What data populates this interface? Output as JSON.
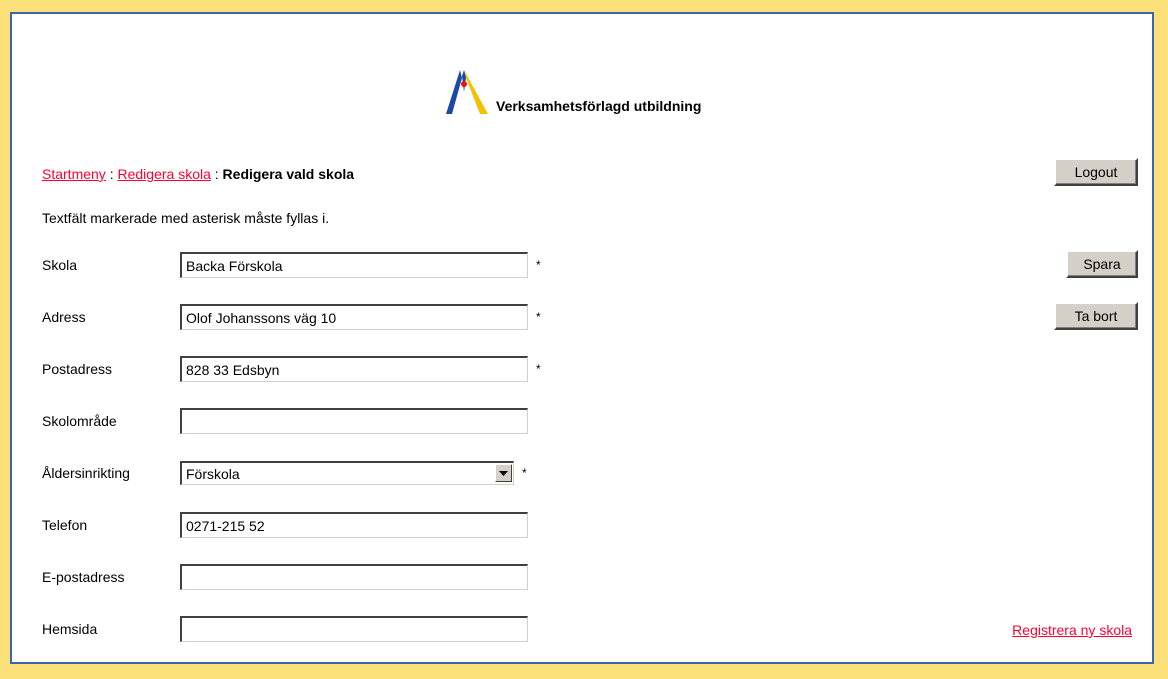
{
  "header": {
    "logo_text": "Verksamhetsförlagd utbildning"
  },
  "breadcrumb": {
    "items": [
      "Startmeny",
      "Redigera skola"
    ],
    "separator": ":",
    "current": "Redigera vald skola"
  },
  "buttons": {
    "logout": "Logout",
    "save": "Spara",
    "delete": "Ta bort"
  },
  "intro_text": "Textfält markerade med asterisk måste fyllas i.",
  "required_marker": "*",
  "form": {
    "skola": {
      "label": "Skola",
      "value": "Backa Förskola"
    },
    "adress": {
      "label": "Adress",
      "value": "Olof Johanssons väg 10"
    },
    "postadress": {
      "label": "Postadress",
      "value": "828 33 Edsbyn"
    },
    "skolomrade": {
      "label": "Skolområde",
      "value": ""
    },
    "aldersinrikting": {
      "label": "Åldersinrikting",
      "value": "Förskola"
    },
    "telefon": {
      "label": "Telefon",
      "value": "0271-215 52"
    },
    "epost": {
      "label": "E-postadress",
      "value": ""
    },
    "hemsida": {
      "label": "Hemsida",
      "value": ""
    }
  },
  "register_link": "Registrera ny skola",
  "colors": {
    "background": "#fbe07a",
    "frame_border": "#3d66a8",
    "link": "#ff0033",
    "button_face": "#d4d0c8"
  }
}
